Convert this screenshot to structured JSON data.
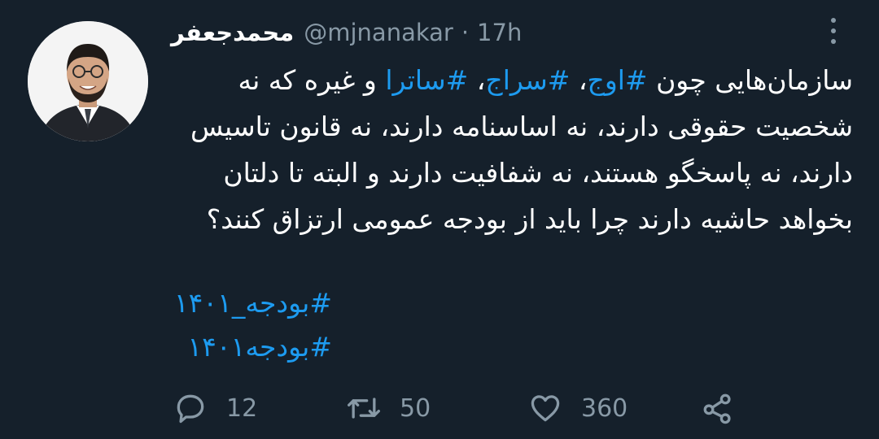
{
  "tweet": {
    "author_name": "محمدجعفر",
    "handle": "@mjnanakar",
    "separator": "·",
    "time": "17h",
    "body_segments": [
      {
        "text": "سازمان‌هایی چون ",
        "tag": false
      },
      {
        "text": "#اوج",
        "tag": true
      },
      {
        "text": "، ",
        "tag": false
      },
      {
        "text": "#سراج",
        "tag": true
      },
      {
        "text": "، ",
        "tag": false
      },
      {
        "text": "#ساترا",
        "tag": true
      },
      {
        "text": " و غیره که نه شخصیت حقوقی دارند، نه اساسنامه دارند، نه قانون تاسیس دارند، نه پاسخگو هستند، نه شفافیت دارند و البته تا دلتان بخواهد حاشیه دارند چرا باید از بودجه عمومی ارتزاق کنند؟",
        "tag": false
      }
    ],
    "hashtags": [
      "#بودجه_۱۴۰۱",
      "#بودجه۱۴۰۱"
    ]
  },
  "actions": {
    "reply": {
      "icon": "reply-icon",
      "count": "12"
    },
    "retweet": {
      "icon": "retweet-icon",
      "count": "50"
    },
    "like": {
      "icon": "like-icon",
      "count": "360"
    },
    "share": {
      "icon": "share-icon"
    }
  },
  "colors": {
    "background": "#15202b",
    "text": "#ffffff",
    "secondary": "#8899a6",
    "link": "#1d9bf0"
  }
}
